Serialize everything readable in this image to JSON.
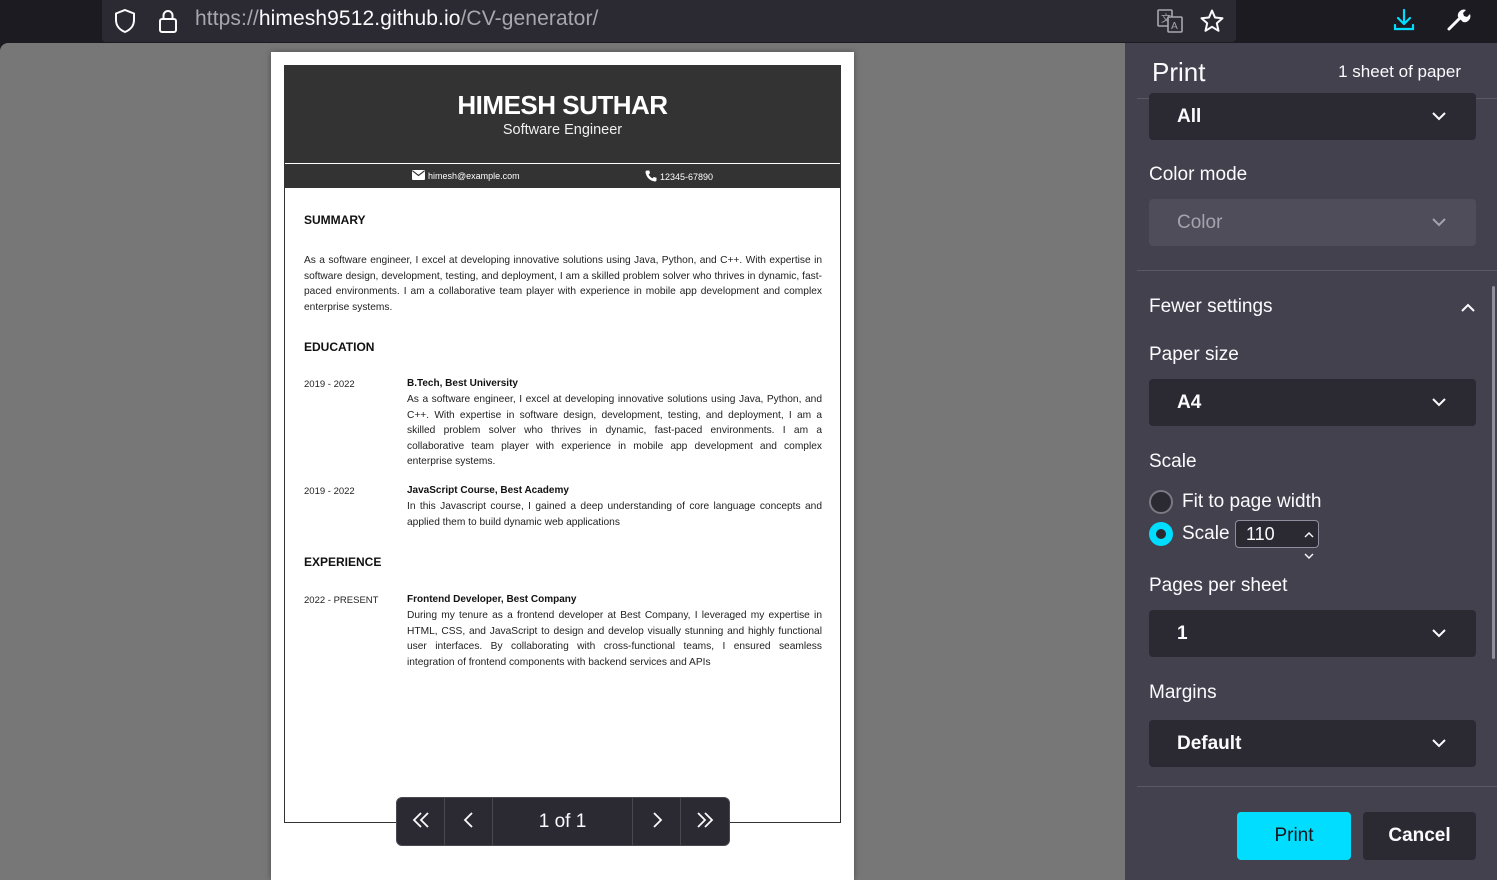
{
  "browser": {
    "url_prefix": "https://",
    "url_domain": "himesh9512.github.io",
    "url_path": "/CV-generator/"
  },
  "cv": {
    "name": "HIMESH SUTHAR",
    "role": "Software Engineer",
    "email": "himesh@example.com",
    "phone": "12345-67890",
    "summary_heading": "SUMMARY",
    "summary_text": "As a software engineer, I excel at developing innovative solutions using Java, Python, and C++. With expertise in software design, development, testing, and deployment, I am a skilled problem solver who thrives in dynamic, fast-paced environments. I am a collaborative team player with experience in mobile app development and complex enterprise systems.",
    "education_heading": "EDUCATION",
    "education": [
      {
        "date": "2019 - 2022",
        "title": "B.Tech, Best University",
        "text": "As a software engineer, I excel at developing innovative solutions using Java, Python, and C++. With expertise in software design, development, testing, and deployment, I am a skilled problem solver who thrives in dynamic, fast-paced environments. I am a collaborative team player with experience in mobile app development and complex enterprise systems."
      },
      {
        "date": "2019 - 2022",
        "title": "JavaScript Course, Best Academy",
        "text": "In this Javascript course, I gained a deep understanding of core language concepts and applied them to build dynamic web applications"
      }
    ],
    "experience_heading": "EXPERIENCE",
    "experience": [
      {
        "date": "2022 - PRESENT",
        "title": "Frontend Developer, Best Company",
        "text": "During my tenure as a frontend developer at Best Company, I leveraged my expertise in HTML, CSS, and JavaScript to design and develop visually stunning and highly functional user interfaces. By collaborating with cross-functional teams, I ensured seamless integration of frontend components with backend services and APIs"
      }
    ]
  },
  "pagenav": {
    "label": "1 of 1"
  },
  "print_panel": {
    "title": "Print",
    "sheet_count": "1 sheet of paper",
    "pages_value": "All",
    "color_mode_label": "Color mode",
    "color_mode_value": "Color",
    "fewer_settings_label": "Fewer settings",
    "paper_size_label": "Paper size",
    "paper_size_value": "A4",
    "scale_label": "Scale",
    "fit_to_width_label": "Fit to page width",
    "scale_option_label": "Scale",
    "scale_value": "110",
    "pages_per_sheet_label": "Pages per sheet",
    "pages_per_sheet_value": "1",
    "margins_label": "Margins",
    "margins_value": "Default",
    "print_button": "Print",
    "cancel_button": "Cancel"
  },
  "colors": {
    "accent": "#00ddff",
    "panel_bg": "#42414d",
    "control_bg": "#2b2a33",
    "cv_header_bg": "#333333",
    "preview_bg": "#777777"
  },
  "icons": [
    "shield-icon",
    "lock-icon",
    "translate-icon",
    "star-icon",
    "download-icon",
    "wrench-icon",
    "email-icon",
    "phone-icon",
    "chevron-down-icon",
    "chevron-up-icon",
    "first-page-icon",
    "prev-page-icon",
    "next-page-icon",
    "last-page-icon"
  ]
}
